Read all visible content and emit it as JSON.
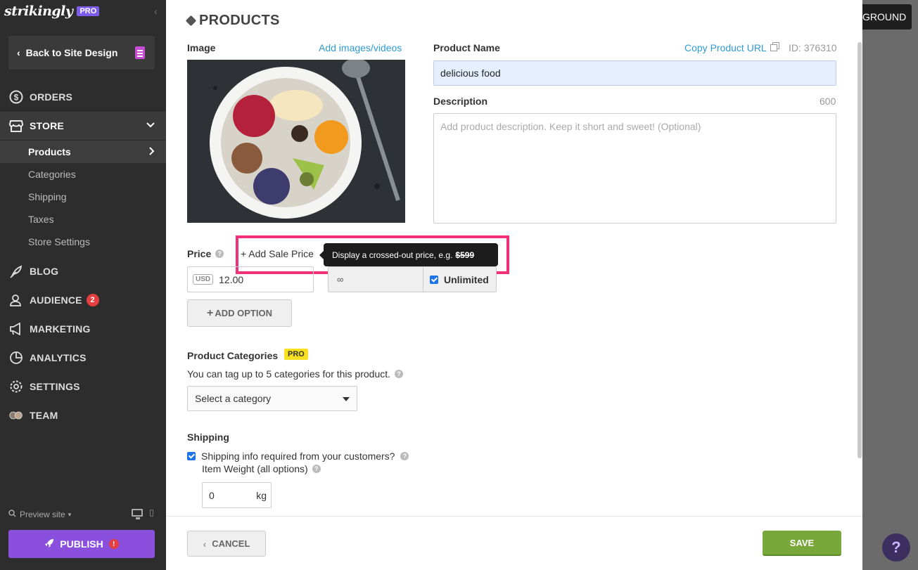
{
  "brand": {
    "name": "strikingly",
    "plan_badge": "PRO"
  },
  "sidebar": {
    "back_label": "Back to Site Design",
    "nav": [
      {
        "label": "ORDERS",
        "icon": "dollar-circle-icon"
      },
      {
        "label": "STORE",
        "icon": "storefront-icon"
      },
      {
        "label": "BLOG",
        "icon": "feather-icon"
      },
      {
        "label": "AUDIENCE",
        "icon": "users-icon",
        "badge": "2"
      },
      {
        "label": "MARKETING",
        "icon": "megaphone-icon"
      },
      {
        "label": "ANALYTICS",
        "icon": "pie-chart-icon"
      },
      {
        "label": "SETTINGS",
        "icon": "gear-icon"
      },
      {
        "label": "TEAM",
        "icon": "team-avatars-icon"
      }
    ],
    "store_sub": [
      "Products",
      "Categories",
      "Shipping",
      "Taxes",
      "Store Settings"
    ],
    "preview_label": "Preview site",
    "publish_label": "PUBLISH",
    "publish_warning": "!"
  },
  "page": {
    "title": "PRODUCTS",
    "image_label": "Image",
    "add_media_link": "Add images/videos",
    "product_name_label": "Product Name",
    "copy_url_link": "Copy Product URL",
    "product_id": "ID: 376310",
    "product_name_value": "delicious food",
    "description_label": "Description",
    "description_limit": "600",
    "description_placeholder": "Add product description. Keep it short and sweet! (Optional)",
    "price_label": "Price",
    "add_sale_price": "+ Add Sale Price",
    "tooltip_text": "Display a crossed-out price, e.g.",
    "tooltip_example": "$599",
    "currency": "USD",
    "price_value": "12.00",
    "stock_value": "∞",
    "unlimited_label": "Unlimited",
    "add_option_label": "ADD OPTION",
    "categories_label": "Product Categories",
    "categories_badge": "PRO",
    "categories_hint": "You can tag up to 5 categories for this product.",
    "category_select": "Select a category",
    "shipping_label": "Shipping",
    "shipping_required_label": "Shipping info required from your customers?",
    "item_weight_label": "Item Weight (all options)",
    "weight_value": "0",
    "weight_unit": "kg",
    "cancel_label": "CANCEL",
    "save_label": "SAVE"
  },
  "overlay": {
    "background_button": "GROUND",
    "help_button": "?"
  },
  "colors": {
    "sidebar_bg": "#2d2d2d",
    "publish": "#8a4fdc",
    "save": "#79a83a",
    "link": "#2e9bd6",
    "highlight": "#f0317a"
  }
}
